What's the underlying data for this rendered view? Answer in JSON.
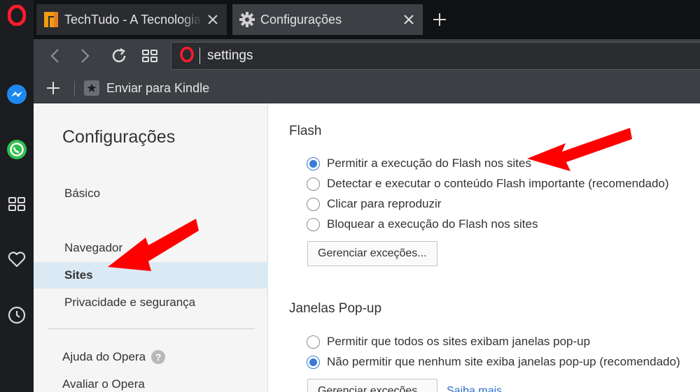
{
  "tabs": [
    {
      "title": "TechTudo - A Tecnologia Descomplicada",
      "favicon": "techtudo-favicon"
    },
    {
      "title": "Configurações",
      "favicon": "gear-icon"
    }
  ],
  "address": {
    "value": "settings"
  },
  "bookmarks": [
    {
      "label": "Enviar para Kindle"
    }
  ],
  "sidebar_icons": [
    "opera-logo-icon",
    "messenger-icon",
    "whatsapp-icon",
    "speed-dial-icon",
    "heart-icon",
    "history-clock-icon"
  ],
  "settings_nav": {
    "title": "Configurações",
    "items": [
      {
        "label": "Básico"
      },
      {
        "label": "Navegador"
      },
      {
        "label": "Sites"
      },
      {
        "label": "Privacidade e segurança"
      }
    ],
    "footer": [
      {
        "label": "Ajuda do Opera"
      },
      {
        "label": "Avaliar o Opera"
      }
    ]
  },
  "flash": {
    "title": "Flash",
    "options": [
      "Permitir a execução do Flash nos sites",
      "Detectar e executar o conteúdo Flash importante (recomendado)",
      "Clicar para reproduzir",
      "Bloquear a execução do Flash nos sites"
    ],
    "selected_index": 0,
    "manage_button": "Gerenciar exceções..."
  },
  "popups": {
    "title": "Janelas Pop-up",
    "options": [
      "Permitir que todos os sites exibam janelas pop-up",
      "Não permitir que nenhum site exiba janelas pop-up (recomendado)"
    ],
    "selected_index": 1,
    "manage_button": "Gerenciar exceções...",
    "learn_more": "Saiba mais"
  },
  "colors": {
    "accent": "#3a7bd5",
    "annotation_arrow": "#ff0000",
    "opera_red": "#ff1b2d"
  }
}
